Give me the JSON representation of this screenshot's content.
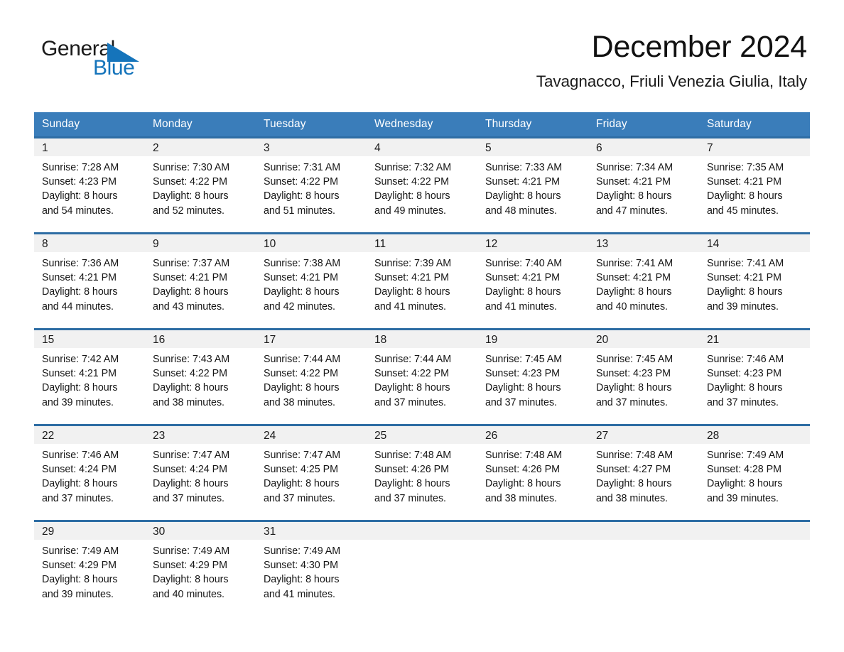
{
  "brand": {
    "name_part1": "General",
    "name_part2": "Blue",
    "accent_color": "#1574bb",
    "logo_icon": "triangle-flag-icon"
  },
  "header": {
    "title": "December 2024",
    "subtitle": "Tavagnacco, Friuli Venezia Giulia, Italy"
  },
  "calendar": {
    "header_bg": "#3a7dba",
    "row_divider_color": "#2e6da4",
    "daynum_band_bg": "#f1f1f1",
    "weekday_headers": [
      "Sunday",
      "Monday",
      "Tuesday",
      "Wednesday",
      "Thursday",
      "Friday",
      "Saturday"
    ],
    "weeks": [
      [
        {
          "day": "1",
          "sunrise": "Sunrise: 7:28 AM",
          "sunset": "Sunset: 4:23 PM",
          "daylight_line1": "Daylight: 8 hours",
          "daylight_line2": "and 54 minutes."
        },
        {
          "day": "2",
          "sunrise": "Sunrise: 7:30 AM",
          "sunset": "Sunset: 4:22 PM",
          "daylight_line1": "Daylight: 8 hours",
          "daylight_line2": "and 52 minutes."
        },
        {
          "day": "3",
          "sunrise": "Sunrise: 7:31 AM",
          "sunset": "Sunset: 4:22 PM",
          "daylight_line1": "Daylight: 8 hours",
          "daylight_line2": "and 51 minutes."
        },
        {
          "day": "4",
          "sunrise": "Sunrise: 7:32 AM",
          "sunset": "Sunset: 4:22 PM",
          "daylight_line1": "Daylight: 8 hours",
          "daylight_line2": "and 49 minutes."
        },
        {
          "day": "5",
          "sunrise": "Sunrise: 7:33 AM",
          "sunset": "Sunset: 4:21 PM",
          "daylight_line1": "Daylight: 8 hours",
          "daylight_line2": "and 48 minutes."
        },
        {
          "day": "6",
          "sunrise": "Sunrise: 7:34 AM",
          "sunset": "Sunset: 4:21 PM",
          "daylight_line1": "Daylight: 8 hours",
          "daylight_line2": "and 47 minutes."
        },
        {
          "day": "7",
          "sunrise": "Sunrise: 7:35 AM",
          "sunset": "Sunset: 4:21 PM",
          "daylight_line1": "Daylight: 8 hours",
          "daylight_line2": "and 45 minutes."
        }
      ],
      [
        {
          "day": "8",
          "sunrise": "Sunrise: 7:36 AM",
          "sunset": "Sunset: 4:21 PM",
          "daylight_line1": "Daylight: 8 hours",
          "daylight_line2": "and 44 minutes."
        },
        {
          "day": "9",
          "sunrise": "Sunrise: 7:37 AM",
          "sunset": "Sunset: 4:21 PM",
          "daylight_line1": "Daylight: 8 hours",
          "daylight_line2": "and 43 minutes."
        },
        {
          "day": "10",
          "sunrise": "Sunrise: 7:38 AM",
          "sunset": "Sunset: 4:21 PM",
          "daylight_line1": "Daylight: 8 hours",
          "daylight_line2": "and 42 minutes."
        },
        {
          "day": "11",
          "sunrise": "Sunrise: 7:39 AM",
          "sunset": "Sunset: 4:21 PM",
          "daylight_line1": "Daylight: 8 hours",
          "daylight_line2": "and 41 minutes."
        },
        {
          "day": "12",
          "sunrise": "Sunrise: 7:40 AM",
          "sunset": "Sunset: 4:21 PM",
          "daylight_line1": "Daylight: 8 hours",
          "daylight_line2": "and 41 minutes."
        },
        {
          "day": "13",
          "sunrise": "Sunrise: 7:41 AM",
          "sunset": "Sunset: 4:21 PM",
          "daylight_line1": "Daylight: 8 hours",
          "daylight_line2": "and 40 minutes."
        },
        {
          "day": "14",
          "sunrise": "Sunrise: 7:41 AM",
          "sunset": "Sunset: 4:21 PM",
          "daylight_line1": "Daylight: 8 hours",
          "daylight_line2": "and 39 minutes."
        }
      ],
      [
        {
          "day": "15",
          "sunrise": "Sunrise: 7:42 AM",
          "sunset": "Sunset: 4:21 PM",
          "daylight_line1": "Daylight: 8 hours",
          "daylight_line2": "and 39 minutes."
        },
        {
          "day": "16",
          "sunrise": "Sunrise: 7:43 AM",
          "sunset": "Sunset: 4:22 PM",
          "daylight_line1": "Daylight: 8 hours",
          "daylight_line2": "and 38 minutes."
        },
        {
          "day": "17",
          "sunrise": "Sunrise: 7:44 AM",
          "sunset": "Sunset: 4:22 PM",
          "daylight_line1": "Daylight: 8 hours",
          "daylight_line2": "and 38 minutes."
        },
        {
          "day": "18",
          "sunrise": "Sunrise: 7:44 AM",
          "sunset": "Sunset: 4:22 PM",
          "daylight_line1": "Daylight: 8 hours",
          "daylight_line2": "and 37 minutes."
        },
        {
          "day": "19",
          "sunrise": "Sunrise: 7:45 AM",
          "sunset": "Sunset: 4:23 PM",
          "daylight_line1": "Daylight: 8 hours",
          "daylight_line2": "and 37 minutes."
        },
        {
          "day": "20",
          "sunrise": "Sunrise: 7:45 AM",
          "sunset": "Sunset: 4:23 PM",
          "daylight_line1": "Daylight: 8 hours",
          "daylight_line2": "and 37 minutes."
        },
        {
          "day": "21",
          "sunrise": "Sunrise: 7:46 AM",
          "sunset": "Sunset: 4:23 PM",
          "daylight_line1": "Daylight: 8 hours",
          "daylight_line2": "and 37 minutes."
        }
      ],
      [
        {
          "day": "22",
          "sunrise": "Sunrise: 7:46 AM",
          "sunset": "Sunset: 4:24 PM",
          "daylight_line1": "Daylight: 8 hours",
          "daylight_line2": "and 37 minutes."
        },
        {
          "day": "23",
          "sunrise": "Sunrise: 7:47 AM",
          "sunset": "Sunset: 4:24 PM",
          "daylight_line1": "Daylight: 8 hours",
          "daylight_line2": "and 37 minutes."
        },
        {
          "day": "24",
          "sunrise": "Sunrise: 7:47 AM",
          "sunset": "Sunset: 4:25 PM",
          "daylight_line1": "Daylight: 8 hours",
          "daylight_line2": "and 37 minutes."
        },
        {
          "day": "25",
          "sunrise": "Sunrise: 7:48 AM",
          "sunset": "Sunset: 4:26 PM",
          "daylight_line1": "Daylight: 8 hours",
          "daylight_line2": "and 37 minutes."
        },
        {
          "day": "26",
          "sunrise": "Sunrise: 7:48 AM",
          "sunset": "Sunset: 4:26 PM",
          "daylight_line1": "Daylight: 8 hours",
          "daylight_line2": "and 38 minutes."
        },
        {
          "day": "27",
          "sunrise": "Sunrise: 7:48 AM",
          "sunset": "Sunset: 4:27 PM",
          "daylight_line1": "Daylight: 8 hours",
          "daylight_line2": "and 38 minutes."
        },
        {
          "day": "28",
          "sunrise": "Sunrise: 7:49 AM",
          "sunset": "Sunset: 4:28 PM",
          "daylight_line1": "Daylight: 8 hours",
          "daylight_line2": "and 39 minutes."
        }
      ],
      [
        {
          "day": "29",
          "sunrise": "Sunrise: 7:49 AM",
          "sunset": "Sunset: 4:29 PM",
          "daylight_line1": "Daylight: 8 hours",
          "daylight_line2": "and 39 minutes."
        },
        {
          "day": "30",
          "sunrise": "Sunrise: 7:49 AM",
          "sunset": "Sunset: 4:29 PM",
          "daylight_line1": "Daylight: 8 hours",
          "daylight_line2": "and 40 minutes."
        },
        {
          "day": "31",
          "sunrise": "Sunrise: 7:49 AM",
          "sunset": "Sunset: 4:30 PM",
          "daylight_line1": "Daylight: 8 hours",
          "daylight_line2": "and 41 minutes."
        },
        {
          "day": "",
          "sunrise": "",
          "sunset": "",
          "daylight_line1": "",
          "daylight_line2": ""
        },
        {
          "day": "",
          "sunrise": "",
          "sunset": "",
          "daylight_line1": "",
          "daylight_line2": ""
        },
        {
          "day": "",
          "sunrise": "",
          "sunset": "",
          "daylight_line1": "",
          "daylight_line2": ""
        },
        {
          "day": "",
          "sunrise": "",
          "sunset": "",
          "daylight_line1": "",
          "daylight_line2": ""
        }
      ]
    ]
  }
}
